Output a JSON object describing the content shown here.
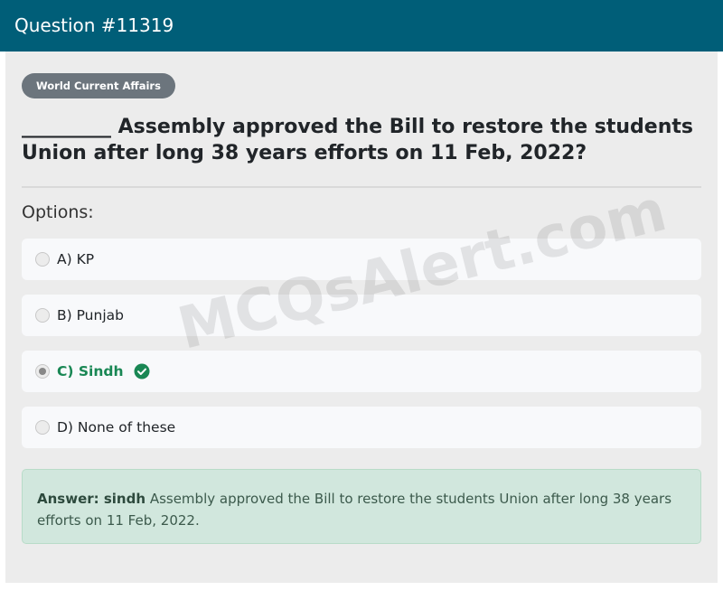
{
  "header": {
    "title": "Question #11319"
  },
  "category_badge": "World Current Affairs",
  "question_text": "_________ Assembly approved the Bill to restore the students Union after long 38 years efforts on 11 Feb, 2022?",
  "options_label": "Options:",
  "options": [
    {
      "label": "A) KP",
      "selected": false,
      "correct": false
    },
    {
      "label": "B) Punjab",
      "selected": false,
      "correct": false
    },
    {
      "label": "C) Sindh",
      "selected": true,
      "correct": true
    },
    {
      "label": "D) None of these",
      "selected": false,
      "correct": false
    }
  ],
  "answer": {
    "prefix": "Answer: sindh",
    "text": "Assembly approved the Bill to restore the students Union after long 38 years efforts on 11 Feb, 2022."
  },
  "watermark": "MCQsAlert.com",
  "colors": {
    "header_bg": "#005e78",
    "correct": "#198754",
    "answer_bg": "#d1e7dd"
  }
}
